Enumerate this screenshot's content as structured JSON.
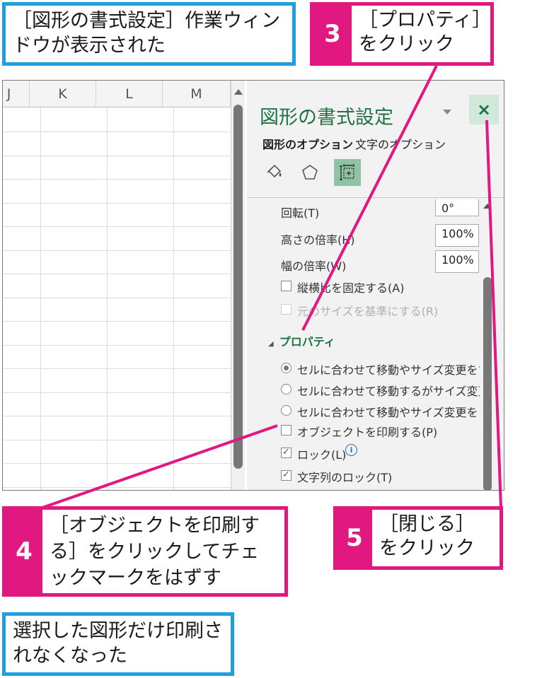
{
  "callouts": {
    "window_shown": "［図形の書式設定］作業ウィンドウが表示された",
    "step3": {
      "num": "3",
      "text": "［プロパティ］をクリック"
    },
    "step4": {
      "num": "4",
      "text": "［オブジェクトを印刷する］をクリックしてチェックマークをはずす"
    },
    "step5": {
      "num": "5",
      "text": "［閉じる］をクリック"
    },
    "result": "選択した図形だけ印刷されなくなった"
  },
  "sheet": {
    "columns": [
      "J",
      "K",
      "L",
      "M"
    ]
  },
  "pane": {
    "title": "図形の書式設定",
    "close": "×",
    "tabs": [
      "図形のオプション",
      "文字のオプション"
    ],
    "rows": {
      "rotation_label": "回転(T)",
      "rotation_value": "0°",
      "height_label": "高さの倍率(H)",
      "height_value": "100%",
      "width_label": "幅の倍率(W)",
      "width_value": "100%",
      "lock_aspect": "縦横比を固定する(A)",
      "relative_original": "元のサイズを基準にする(R)"
    },
    "section_title": "プロパティ",
    "radios": [
      "セルに合わせて移動やサイズ変更をする(S)",
      "セルに合わせて移動するがサイズ変更はしな",
      "セルに合わせて移動やサイズ変更をしない("
    ],
    "print_object": "オブジェクトを印刷する(P)",
    "locked": "ロック(L)",
    "lock_text": "文字列のロック(T)",
    "info_icon": "i"
  },
  "colors": {
    "accent_pink": "#e0187f",
    "accent_blue": "#1ea0dc",
    "excel_green": "#217346"
  }
}
